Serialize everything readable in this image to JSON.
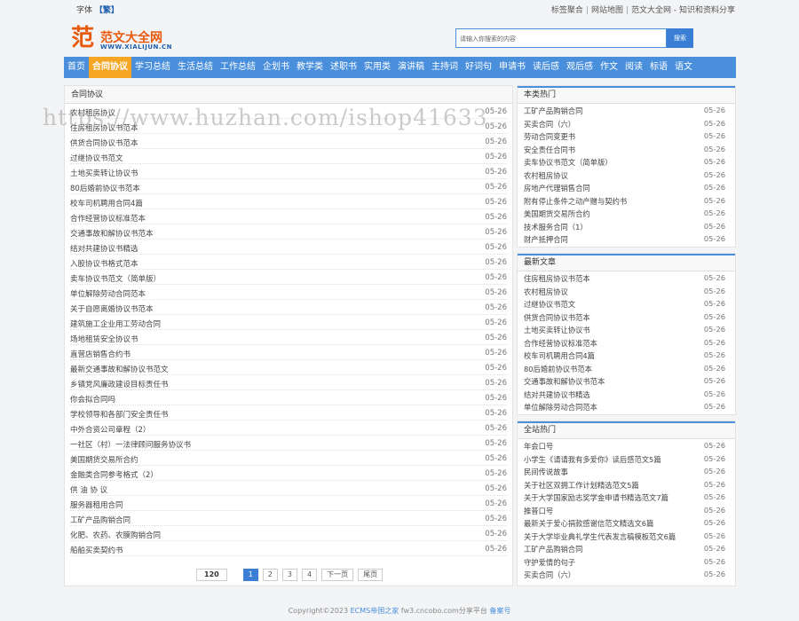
{
  "topbar": {
    "font_label": "字体",
    "font_value": "【繁】",
    "links": [
      "标签聚合",
      "网站地图",
      "范文大全网 - 知识和资料分享"
    ]
  },
  "logo": {
    "glyph": "范",
    "name": "范文大全网",
    "url": "WWW.XIALIJUN.CN"
  },
  "search": {
    "placeholder": "请输入你搜索的内容",
    "button": "搜索"
  },
  "nav": [
    "首页",
    "合同协议",
    "学习总结",
    "生活总结",
    "工作总结",
    "企划书",
    "教学类",
    "述职书",
    "实用类",
    "演讲稿",
    "主持词",
    "好词句",
    "申请书",
    "读后感",
    "观后感",
    "作文",
    "阅读",
    "标语",
    "语文"
  ],
  "nav_active": "合同协议",
  "main": {
    "title": "合同协议",
    "items": [
      {
        "t": "农村租房协议",
        "d": "05-26"
      },
      {
        "t": "住房租房协议书范本",
        "d": "05-26"
      },
      {
        "t": "供货合同协议书范本",
        "d": "05-26"
      },
      {
        "t": "过继协议书范文",
        "d": "05-26"
      },
      {
        "t": "土地买卖转让协议书",
        "d": "05-26"
      },
      {
        "t": "80后婚前协议书范本",
        "d": "05-26"
      },
      {
        "t": "校车司机聘用合同4篇",
        "d": "05-26"
      },
      {
        "t": "合作经营协议标准范本",
        "d": "05-26"
      },
      {
        "t": "交通事故和解协议书范本",
        "d": "05-26"
      },
      {
        "t": "结对共建协议书精选",
        "d": "05-26"
      },
      {
        "t": "入股协议书格式范本",
        "d": "05-26"
      },
      {
        "t": "卖车协议书范文（简单版）",
        "d": "05-26"
      },
      {
        "t": "单位解除劳动合同范本",
        "d": "05-26"
      },
      {
        "t": "关于自愿离婚协议书范本",
        "d": "05-26"
      },
      {
        "t": "建筑施工企业用工劳动合同",
        "d": "05-26"
      },
      {
        "t": "场地租赁安全协议书",
        "d": "05-26"
      },
      {
        "t": "直营店销售合约书",
        "d": "05-26"
      },
      {
        "t": "最新交通事故和解协议书范文",
        "d": "05-26"
      },
      {
        "t": "乡镇党风廉政建设目标责任书",
        "d": "05-26"
      },
      {
        "t": "你会拟合同吗",
        "d": "05-26"
      },
      {
        "t": "学校领导和各部门安全责任书",
        "d": "05-26"
      },
      {
        "t": "中外合资公司章程（2）",
        "d": "05-26"
      },
      {
        "t": "一社区（村）一法律顾问服务协议书",
        "d": "05-26"
      },
      {
        "t": "美国期货交易所合约",
        "d": "05-26"
      },
      {
        "t": "金融类合同参考格式（2）",
        "d": "05-26"
      },
      {
        "t": "供 油 协 议",
        "d": "05-26"
      },
      {
        "t": "服务器租用合同",
        "d": "05-26"
      },
      {
        "t": "工矿产品购销合同",
        "d": "05-26"
      },
      {
        "t": "化肥、农药、农膜购销合同",
        "d": "05-26"
      },
      {
        "t": "船舶买卖契约书",
        "d": "05-26"
      }
    ]
  },
  "pager": {
    "total": "120",
    "pages": [
      "1",
      "2",
      "3",
      "4"
    ],
    "current": "1",
    "next": "下一页",
    "last": "尾页"
  },
  "side1": {
    "title": "本类热门",
    "items": [
      {
        "t": "工矿产品购销合同",
        "d": "05-26"
      },
      {
        "t": "买卖合同（六）",
        "d": "05-26"
      },
      {
        "t": "劳动合同变更书",
        "d": "05-26"
      },
      {
        "t": "安全责任合同书",
        "d": "05-26"
      },
      {
        "t": "卖车协议书范文（简单版）",
        "d": "05-26"
      },
      {
        "t": "农村租房协议",
        "d": "05-26"
      },
      {
        "t": "房地产代理销售合同",
        "d": "05-26"
      },
      {
        "t": "附有停止条件之动产赠与契约书",
        "d": "05-26"
      },
      {
        "t": "美国期货交易所合约",
        "d": "05-26"
      },
      {
        "t": "技术服务合同（1）",
        "d": "05-26"
      },
      {
        "t": "财产抵押合同",
        "d": "05-26"
      }
    ]
  },
  "side2": {
    "title": "最新文章",
    "items": [
      {
        "t": "住房租房协议书范本",
        "d": "05-26"
      },
      {
        "t": "农村租房协议",
        "d": "05-26"
      },
      {
        "t": "过继协议书范文",
        "d": "05-26"
      },
      {
        "t": "供货合同协议书范本",
        "d": "05-26"
      },
      {
        "t": "土地买卖转让协议书",
        "d": "05-26"
      },
      {
        "t": "合作经营协议标准范本",
        "d": "05-26"
      },
      {
        "t": "校车司机聘用合同4篇",
        "d": "05-26"
      },
      {
        "t": "80后婚前协议书范本",
        "d": "05-26"
      },
      {
        "t": "交通事故和解协议书范本",
        "d": "05-26"
      },
      {
        "t": "结对共建协议书精选",
        "d": "05-26"
      },
      {
        "t": "单位解除劳动合同范本",
        "d": "05-26"
      }
    ]
  },
  "side3": {
    "title": "全站热门",
    "items": [
      {
        "t": "年会口号",
        "d": "05-26"
      },
      {
        "t": "小学生《请请我有多爱你》读后感范文5篇",
        "d": "05-26"
      },
      {
        "t": "民间传说故事",
        "d": "05-26"
      },
      {
        "t": "关于社区双拥工作计划精选范文5篇",
        "d": "05-26"
      },
      {
        "t": "关于大学国家励志奖学金申请书精选范文7篇",
        "d": "05-26"
      },
      {
        "t": "推普口号",
        "d": "05-26"
      },
      {
        "t": "最新关于爱心捐款感谢信范文精选文6篇",
        "d": "05-26"
      },
      {
        "t": "关于大学毕业典礼学生代表发言稿模板范文6篇",
        "d": "05-26"
      },
      {
        "t": "工矿产品购销合同",
        "d": "05-26"
      },
      {
        "t": "守护爱情的句子",
        "d": "05-26"
      },
      {
        "t": "买卖合同（六）",
        "d": "05-26"
      }
    ]
  },
  "footer": {
    "copyright": "Copyright©2023",
    "link1": "ECMS帝国之家",
    "domain": "fw3.cncobo.com分享平台",
    "icp": "备案号"
  },
  "watermark": "https://www.huzhan.com/ishop41633"
}
